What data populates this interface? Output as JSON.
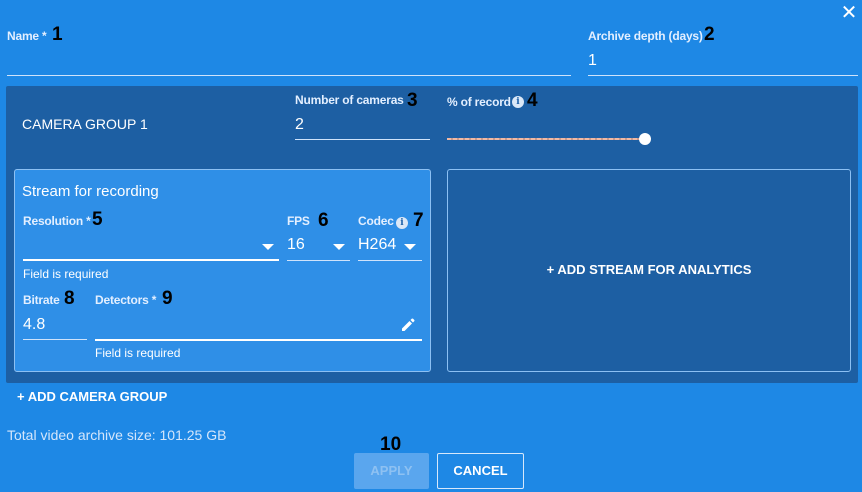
{
  "dialog": {
    "close_glyph": "✕",
    "name": {
      "label": "Name *",
      "value": "",
      "marker": "1"
    },
    "archive_depth": {
      "label": "Archive depth (days)",
      "value": "1",
      "marker": "2"
    }
  },
  "camera_group": {
    "title": "CAMERA GROUP 1",
    "num_cameras": {
      "label": "Number of cameras",
      "value": "2",
      "marker": "3"
    },
    "record_percent": {
      "label": "% of record",
      "info_glyph": "i",
      "marker": "4",
      "level_fraction": 1.0
    },
    "stream_recording": {
      "title": "Stream for recording",
      "resolution": {
        "label": "Resolution *",
        "value": "",
        "error": "Field is required",
        "marker": "5"
      },
      "fps": {
        "label": "FPS",
        "value": "16",
        "marker": "6"
      },
      "codec": {
        "label": "Codec",
        "info_glyph": "i",
        "value": "H264",
        "marker": "7"
      },
      "bitrate": {
        "label": "Bitrate",
        "value": "4.8",
        "marker": "8"
      },
      "detectors": {
        "label": "Detectors *",
        "value": "",
        "error": "Field is required",
        "marker": "9"
      }
    },
    "add_analytics_label": "+ ADD STREAM FOR ANALYTICS"
  },
  "add_group_label": "+ ADD CAMERA GROUP",
  "total_size_text": "Total video archive size: 101.25 GB",
  "footer": {
    "marker": "10",
    "apply_label": "APPLY",
    "cancel_label": "CANCEL"
  },
  "colors": {
    "background": "#1e88e5",
    "group_panel": "#1d5fa3",
    "stream_card": "#2f8fe7"
  }
}
